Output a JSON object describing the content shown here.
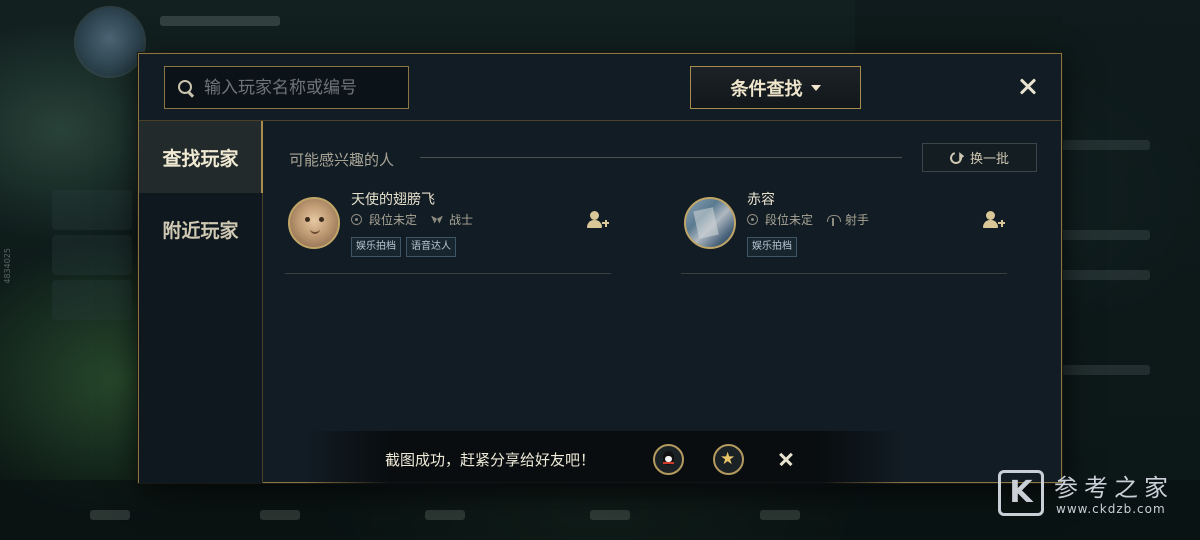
{
  "dialog": {
    "search": {
      "placeholder": "输入玩家名称或编号",
      "value": ""
    },
    "filter_button": "条件查找",
    "sidebar": {
      "items": [
        {
          "label": "查找玩家",
          "active": true
        },
        {
          "label": "附近玩家",
          "active": false
        }
      ]
    },
    "section_title": "可能感兴趣的人",
    "refresh_button": "换一批",
    "players": [
      {
        "name": "天使的翅膀飞",
        "rank": "段位未定",
        "role": "战士",
        "role_icon": "fighter-icon",
        "tags": [
          "娱乐拍档",
          "语音达人"
        ]
      },
      {
        "name": "赤容",
        "rank": "段位未定",
        "role": "射手",
        "role_icon": "marksman-icon",
        "tags": [
          "娱乐拍档"
        ]
      }
    ]
  },
  "toast": {
    "text": "截图成功，赶紧分享给好友吧！"
  },
  "background": {
    "side_id": "4834025"
  },
  "watermark": {
    "logo": "K",
    "title": "参考之家",
    "url": "www.ckdzb.com"
  },
  "colors": {
    "accent_gold": "#a78c4e",
    "panel": "#121c24",
    "tag_border": "#3e5566"
  }
}
